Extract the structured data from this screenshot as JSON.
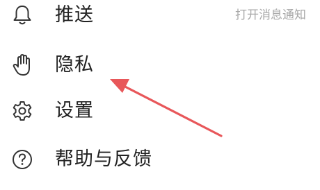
{
  "menu": {
    "items": [
      {
        "label": "推送",
        "hint": "打开消息通知",
        "icon": "bell-icon"
      },
      {
        "label": "隐私",
        "icon": "hand-icon"
      },
      {
        "label": "设置",
        "icon": "gear-icon"
      },
      {
        "label": "帮助与反馈",
        "icon": "help-circle-icon"
      }
    ]
  },
  "annotation": {
    "type": "arrow",
    "color": "#e8575a",
    "points_to": "隐私"
  }
}
